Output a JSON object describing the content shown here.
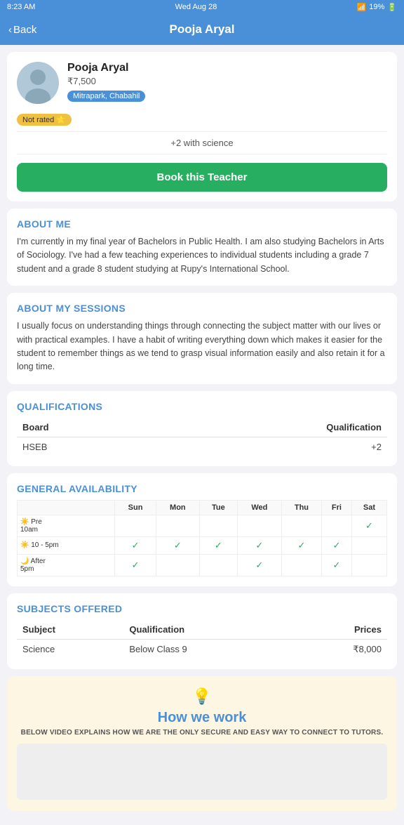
{
  "statusBar": {
    "time": "8:23 AM",
    "date": "Wed Aug 28",
    "battery": "19%",
    "wifiIcon": "wifi",
    "batteryIcon": "battery"
  },
  "header": {
    "backLabel": "Back",
    "title": "Pooja Aryal"
  },
  "profile": {
    "name": "Pooja Aryal",
    "price": "₹7,500",
    "location": "Mitrapark, Chabahil",
    "ratingLabel": "Not rated",
    "scienceTag": "+2 with science",
    "bookButton": "Book this Teacher"
  },
  "aboutMe": {
    "title": "ABOUT ME",
    "text": "I'm currently in my final year of Bachelors in Public Health. I am also studying Bachelors in Arts of Sociology. I've had a few teaching experiences to individual students including a grade 7 student and a grade 8 student studying at Rupy's International School."
  },
  "aboutSessions": {
    "title": "ABOUT MY SESSIONS",
    "text": "I usually focus on understanding things through connecting the subject matter with our lives or with practical examples. I have a habit of writing everything down which makes it easier for the student to remember things as we tend to grasp visual information easily and also retain it for a long time."
  },
  "qualifications": {
    "title": "QUALIFICATIONS",
    "headers": [
      "Board",
      "Qualification"
    ],
    "rows": [
      {
        "board": "HSEB",
        "qualification": "+2"
      }
    ]
  },
  "availability": {
    "title": "GENERAL AVAILABILITY",
    "days": [
      "",
      "Sun",
      "Mon",
      "Tue",
      "Wed",
      "Thu",
      "Fri",
      "Sat"
    ],
    "slots": [
      {
        "label": "☀️ Pre\n10am",
        "sun": false,
        "mon": false,
        "tue": false,
        "wed": false,
        "thu": false,
        "fri": false,
        "sat": true
      },
      {
        "label": "☀️ 10 - 5pm",
        "sun": true,
        "mon": true,
        "tue": true,
        "wed": true,
        "thu": true,
        "fri": true,
        "sat": false
      },
      {
        "label": "🌙 After\n5pm",
        "sun": true,
        "mon": false,
        "tue": false,
        "wed": true,
        "thu": false,
        "fri": true,
        "sat": false
      }
    ]
  },
  "subjects": {
    "title": "SUBJECTS OFFERED",
    "headers": [
      "Subject",
      "Qualification",
      "Prices"
    ],
    "rows": [
      {
        "subject": "Science",
        "qualification": "Below Class 9",
        "price": "₹8,000"
      }
    ]
  },
  "howWeWork": {
    "icon": "💡",
    "title": "How we work",
    "subtitle": "BELOW VIDEO EXPLAINS HOW WE ARE THE ONLY SECURE AND EASY WAY TO CONNECT TO TUTORS."
  }
}
